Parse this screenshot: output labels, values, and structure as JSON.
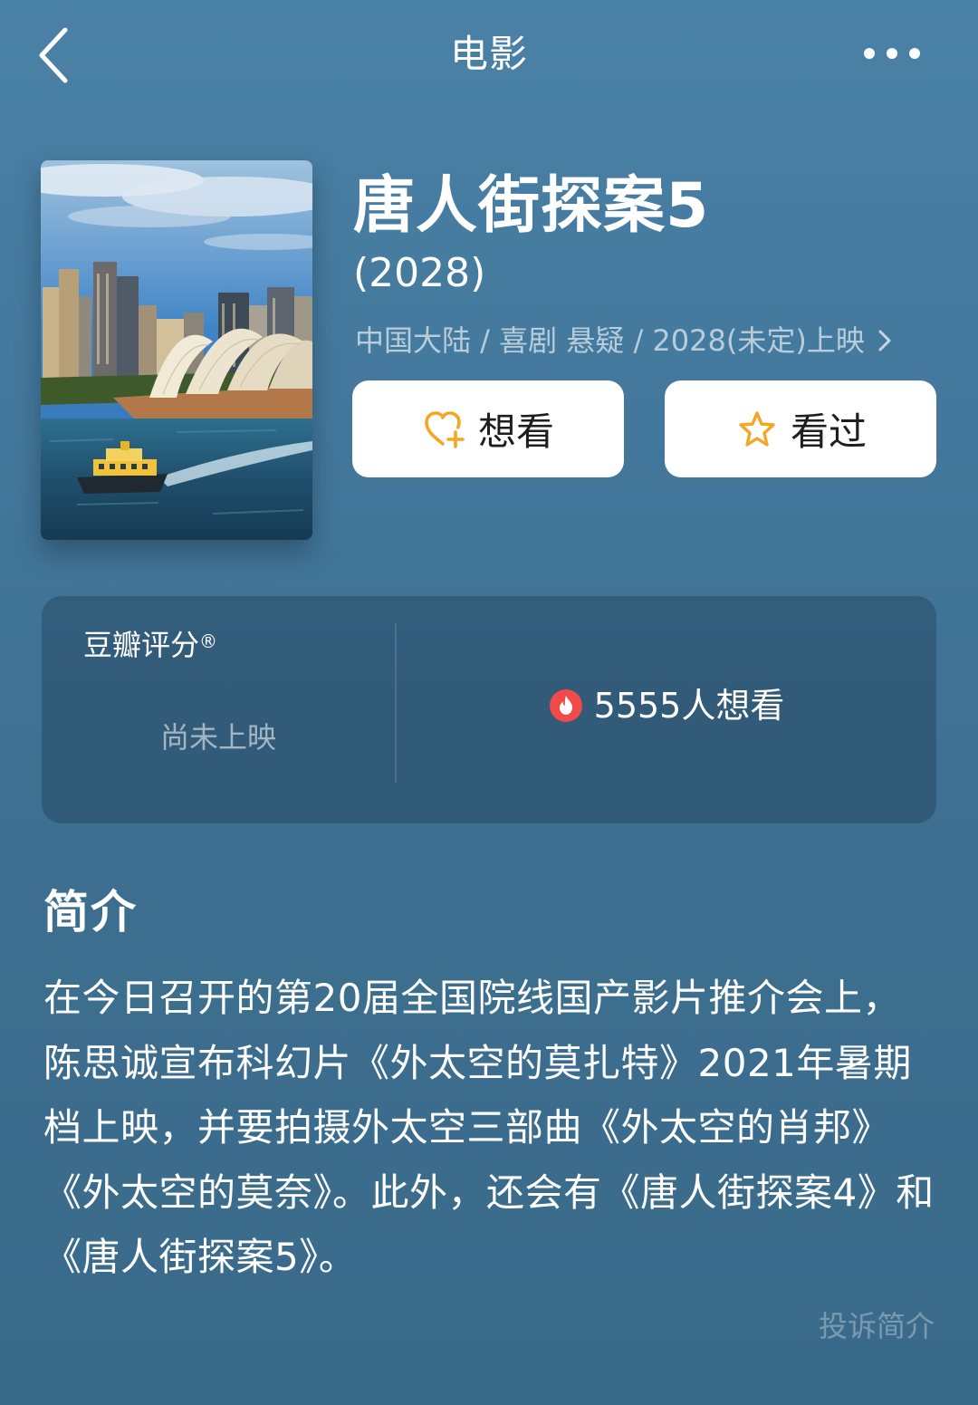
{
  "nav": {
    "title": "电影",
    "back_icon": "chevron-left-icon",
    "more_icon": "more-dots-icon"
  },
  "movie": {
    "title": "唐人街探案5",
    "year": "(2028)",
    "meta": "中国大陆 / 喜剧 悬疑 / 2028(未定)上映",
    "poster_icon": "poster-image"
  },
  "actions": {
    "want_label": "想看",
    "want_icon": "heart-plus-icon",
    "seen_label": "看过",
    "seen_icon": "star-icon",
    "accent_color": "#f5a623"
  },
  "rating": {
    "label": "豆瓣评分",
    "registered_mark": "®",
    "status": "尚未上映",
    "want_count_text": "5555人想看",
    "hot_icon": "flame-icon",
    "hot_color": "#f04a4a"
  },
  "synopsis": {
    "title": "简介",
    "text": "在今日召开的第20届全国院线国产影片推介会上，陈思诚宣布科幻片《外太空的莫扎特》2021年暑期档上映，并要拍摄外太空三部曲《外太空的肖邦》《外太空的莫奈》。此外，还会有《唐人街探案4》和《唐人街探案5》。",
    "report_label": "投诉简介"
  }
}
